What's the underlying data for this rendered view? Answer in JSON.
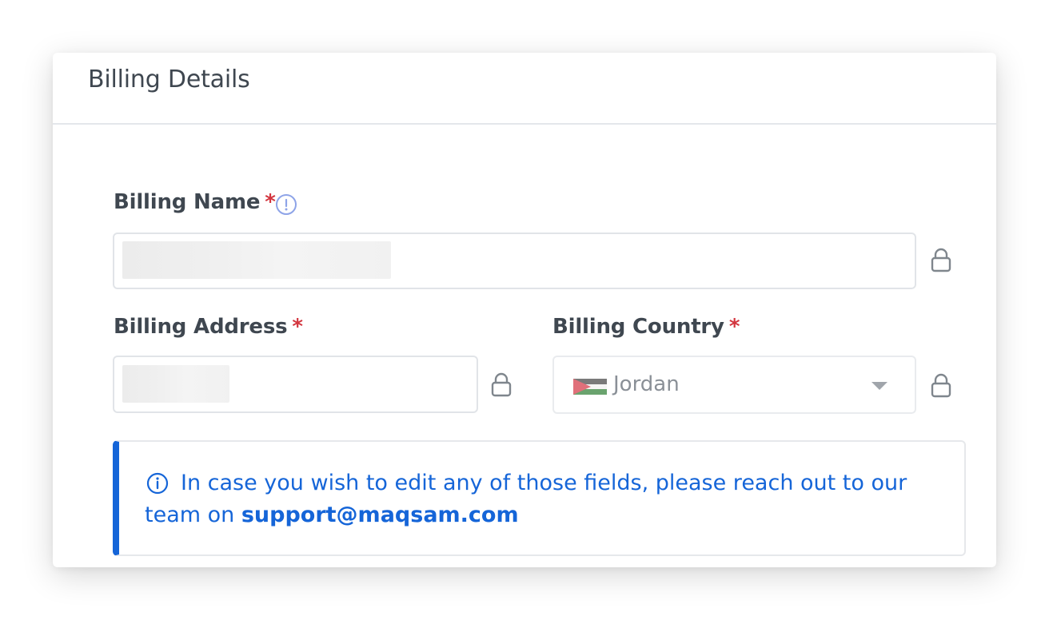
{
  "card": {
    "title": "Billing Details"
  },
  "fields": {
    "billing_name": {
      "label": "Billing Name",
      "required_mark": "*",
      "value": ""
    },
    "billing_address": {
      "label": "Billing Address",
      "required_mark": "*",
      "value": ""
    },
    "billing_country": {
      "label": "Billing Country",
      "required_mark": "*",
      "value": "Jordan"
    }
  },
  "notice": {
    "text": "In case you wish to edit any of those fields, please reach out to our team on ",
    "email": "support@maqsam.com"
  },
  "icons": {
    "info_hint": "info-circle-icon",
    "lock": "lock-icon",
    "flag": "jordan-flag-icon",
    "caret": "caret-down-icon",
    "notice_info": "info-circle-icon"
  },
  "colors": {
    "accent": "#1565d8",
    "required": "#d3363f",
    "label": "#3f4750",
    "hint_icon": "#8ea4e8"
  }
}
